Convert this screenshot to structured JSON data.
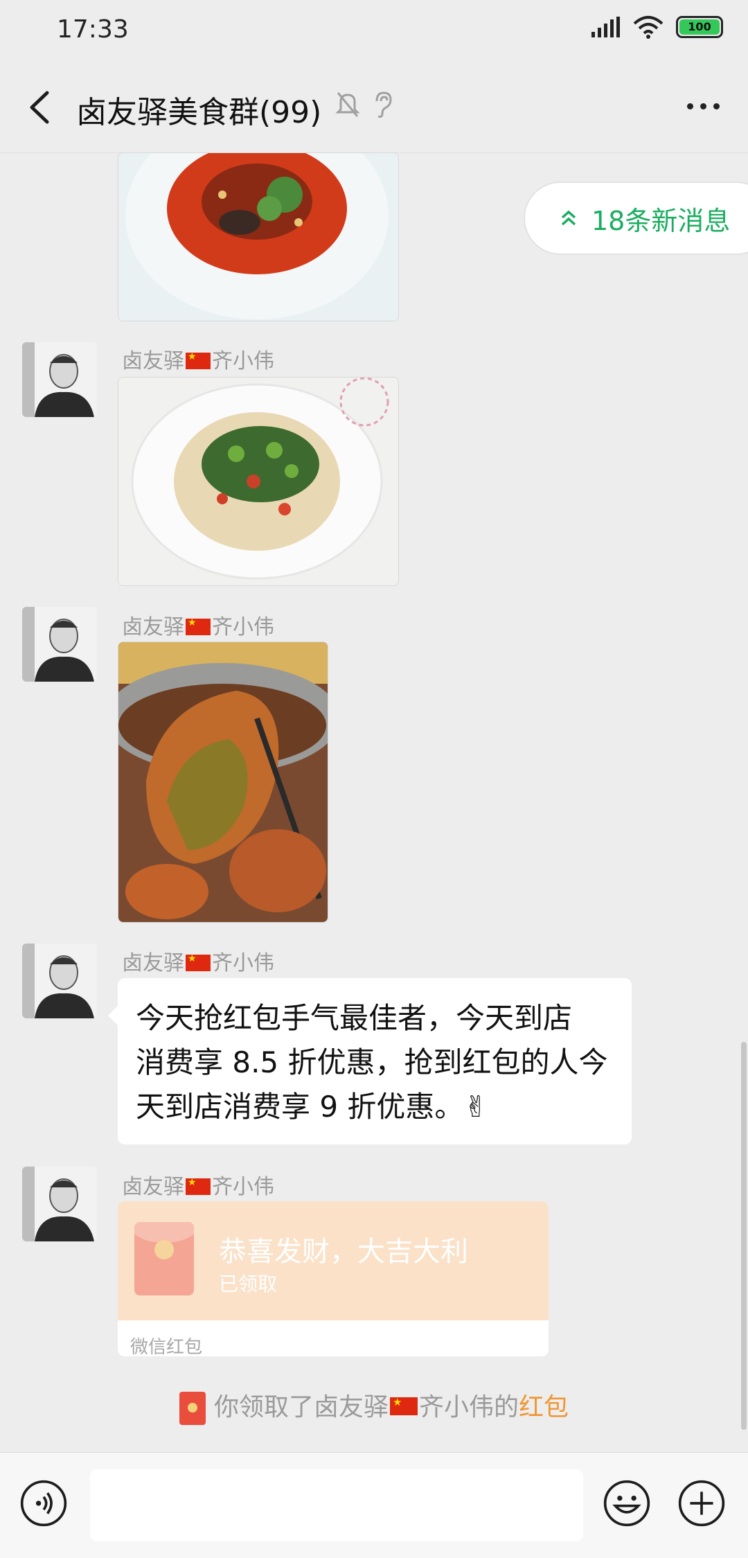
{
  "status_bar": {
    "time": "17:33",
    "battery": "100"
  },
  "header": {
    "title": "卤友驿美食群(99)"
  },
  "new_messages": {
    "label": "18条新消息"
  },
  "messages": [
    {
      "sender_prefix": "卤友驿",
      "sender_name": "齐小伟"
    },
    {
      "sender_prefix": "卤友驿",
      "sender_name": "齐小伟"
    },
    {
      "sender_prefix": "卤友驿",
      "sender_name": "齐小伟",
      "text_lines": [
        "今天抢红包手气最佳者，今天到店",
        "消费享 8.5 折优惠，抢到红包的人今",
        "天到店消费享 9 折优惠。✌"
      ]
    },
    {
      "sender_prefix": "卤友驿",
      "sender_name": "齐小伟"
    }
  ],
  "red_packet": {
    "wish": "恭喜发财，大吉大利",
    "status": "已领取",
    "footer": "微信红包"
  },
  "system_note": {
    "prefix": "你领取了卤友驿",
    "name": "齐小伟的",
    "link": "红包"
  },
  "colors": {
    "accent_green": "#1aad60",
    "red_packet_bg": "#fae1c8",
    "link_orange": "#f09633",
    "background": "#ededed"
  }
}
